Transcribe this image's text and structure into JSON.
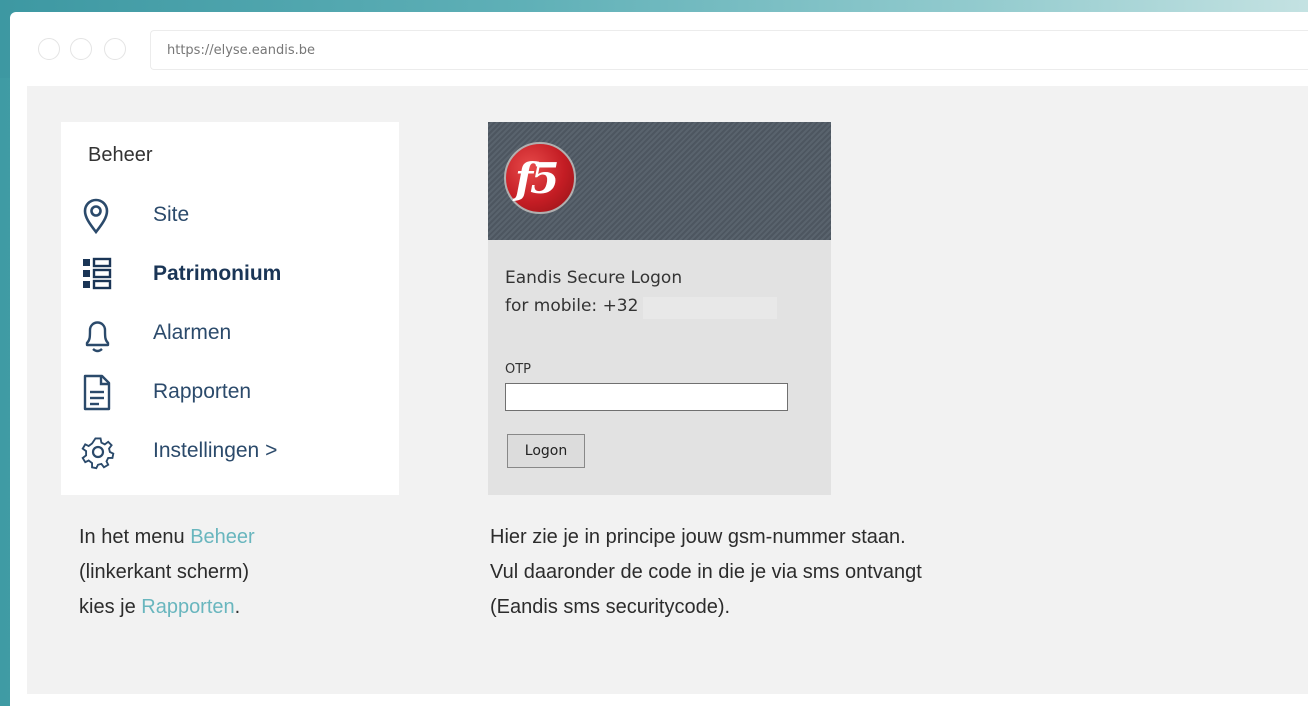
{
  "browser": {
    "url": "https://elyse.eandis.be"
  },
  "menu": {
    "title": "Beheer",
    "items": [
      {
        "label": "Site",
        "icon": "location-pin-icon"
      },
      {
        "label": "Patrimonium",
        "icon": "list-grid-icon",
        "active": true
      },
      {
        "label": "Alarmen",
        "icon": "bell-icon"
      },
      {
        "label": "Rapporten",
        "icon": "document-icon"
      },
      {
        "label": "Instellingen >",
        "icon": "gear-icon"
      }
    ]
  },
  "left_caption": {
    "line1_prefix": "In het menu ",
    "line1_link": "Beheer",
    "line2": "(linkerkant scherm)",
    "line3_prefix": "kies je ",
    "line3_link": "Rapporten",
    "line3_suffix": "."
  },
  "f5_login": {
    "logo_text": "f5",
    "heading": "Eandis Secure Logon",
    "mobile_line": "for mobile: +32",
    "otp_label": "OTP",
    "otp_value": "",
    "logon_button": "Logon"
  },
  "right_caption": {
    "line1": "Hier zie je in principe jouw gsm-nummer staan.",
    "line2": "Vul daaronder de code in die je via sms ontvangt",
    "line3": "(Eandis sms securitycode)."
  },
  "colors": {
    "accent_link": "#69b6be",
    "menu_text": "#2b4a6b",
    "teal_background": "#3f9ba4"
  }
}
